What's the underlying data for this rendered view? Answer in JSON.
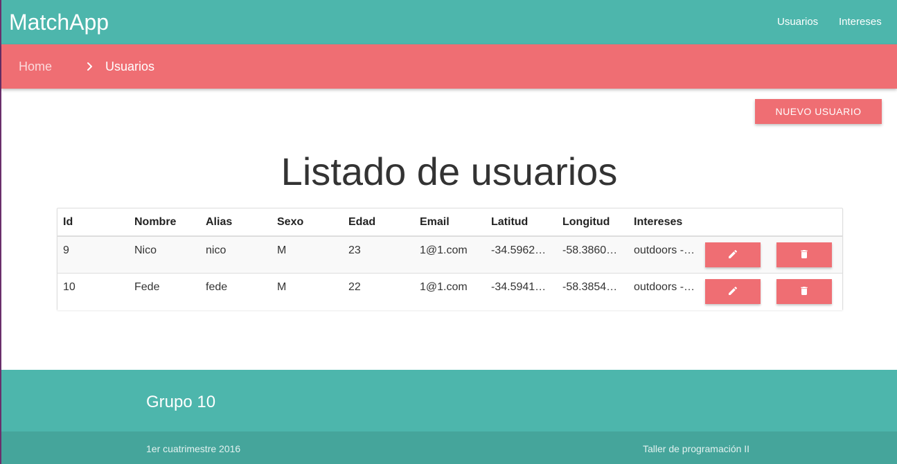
{
  "app": {
    "brand": "MatchApp",
    "nav": [
      {
        "label": "Usuarios"
      },
      {
        "label": "Intereses"
      }
    ]
  },
  "breadcrumb": {
    "home": "Home",
    "current": "Usuarios",
    "separator_icon": "chevron-right-icon"
  },
  "actions": {
    "new_user": "NUEVO USUARIO"
  },
  "page": {
    "title": "Listado de usuarios"
  },
  "table": {
    "headers": [
      "Id",
      "Nombre",
      "Alias",
      "Sexo",
      "Edad",
      "Email",
      "Latitud",
      "Longitud",
      "Intereses"
    ],
    "rows": [
      {
        "id": "9",
        "nombre": "Nico",
        "alias": "nico",
        "sexo": "M",
        "edad": "23",
        "email": "1@1.com",
        "latitud": "-34.5962…",
        "longitud": "-58.3860…",
        "intereses": "outdoors -…"
      },
      {
        "id": "10",
        "nombre": "Fede",
        "alias": "fede",
        "sexo": "M",
        "edad": "22",
        "email": "1@1.com",
        "latitud": "-34.5941…",
        "longitud": "-58.3854…",
        "intereses": "outdoors -…"
      }
    ],
    "row_action_icons": [
      "pencil-icon",
      "trash-icon"
    ]
  },
  "footer": {
    "title": "Grupo 10",
    "left": "1er cuatrimestre 2016",
    "right": "Taller de programación II"
  },
  "colors": {
    "primary": "#4db6ac",
    "accent": "#ef6e73"
  }
}
